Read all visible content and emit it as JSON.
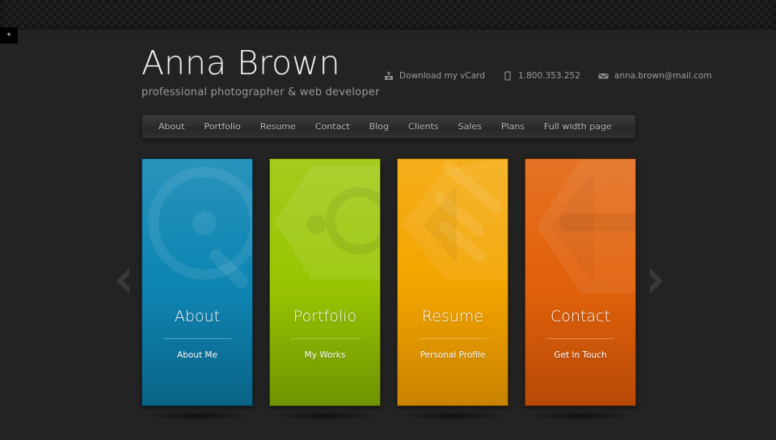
{
  "site": {
    "title": "Anna Brown",
    "tagline": "professional photographer & web developer",
    "background_color": "#232323"
  },
  "contact": {
    "items": [
      {
        "icon": "download-icon",
        "label": "Download my vCard"
      },
      {
        "icon": "phone-icon",
        "label": "1.800.353.252"
      },
      {
        "icon": "mail-icon",
        "label": "anna.brown@mail.com"
      }
    ]
  },
  "nav": {
    "items": [
      {
        "label": "About"
      },
      {
        "label": "Portfolio"
      },
      {
        "label": "Resume"
      },
      {
        "label": "Contact"
      },
      {
        "label": "Blog"
      },
      {
        "label": "Clients"
      },
      {
        "label": "Sales"
      },
      {
        "label": "Plans"
      },
      {
        "label": "Full width page"
      }
    ]
  },
  "cards": [
    {
      "title": "About",
      "subtitle": "About Me",
      "color": "#0f86b4",
      "color_dark": "#0b6f97",
      "watermark": "magnifier-icon"
    },
    {
      "title": "Portfolio",
      "subtitle": "My Works",
      "color": "#9ac503",
      "color_dark": "#7ba400",
      "watermark": "camera-icon"
    },
    {
      "title": "Resume",
      "subtitle": "Personal Profile",
      "color": "#f4a500",
      "color_dark": "#e09100",
      "watermark": "document-lines-icon"
    },
    {
      "title": "Contact",
      "subtitle": "Get In Touch",
      "color": "#e2620b",
      "color_dark": "#cc5207",
      "watermark": "envelope-icon"
    }
  ],
  "slider": {
    "prev_label": "Previous",
    "next_label": "Next"
  },
  "cursor_box": {
    "glyph": "+"
  }
}
